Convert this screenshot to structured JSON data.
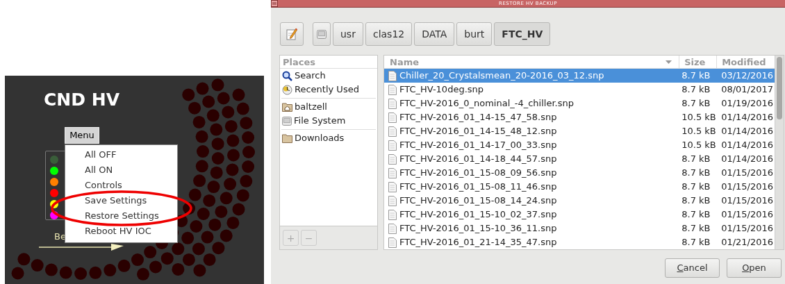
{
  "hv_panel": {
    "title": "CND HV",
    "menu_button": "Menu",
    "legend_dots": [
      {
        "color": "#3a5e3a"
      },
      {
        "color": "#00ff00"
      },
      {
        "color": "#ff8000"
      },
      {
        "color": "#ff0000"
      },
      {
        "color": "#ffff00"
      },
      {
        "color": "#ff00ff"
      }
    ],
    "menu_items": [
      "All OFF",
      "All ON",
      "Controls",
      "Save Settings",
      "Restore Settings",
      "Reboot HV IOC"
    ],
    "partial_label": "Be"
  },
  "dialog": {
    "title": "RESTORE HV BACKUP",
    "path_buttons": [
      {
        "label": "usr",
        "current": false
      },
      {
        "label": "clas12",
        "current": false
      },
      {
        "label": "DATA",
        "current": false
      },
      {
        "label": "burt",
        "current": false
      },
      {
        "label": "FTC_HV",
        "current": true
      }
    ],
    "places_header": "Places",
    "places": [
      {
        "kind": "search",
        "label": "Search"
      },
      {
        "kind": "recent",
        "label": "Recently Used"
      },
      {
        "kind": "home",
        "label": "baltzell"
      },
      {
        "kind": "drive",
        "label": "File System"
      },
      {
        "kind": "folder",
        "label": "Downloads"
      }
    ],
    "places_buttons": [
      "+",
      "−"
    ],
    "columns": [
      "Name",
      "Size",
      "Modified"
    ],
    "files": [
      {
        "name": "Chiller_20_Crystalsmean_20-2016_03_12.snp",
        "size": "8.7 kB",
        "modified": "03/12/2016",
        "selected": true
      },
      {
        "name": "FTC_HV-10deg.snp",
        "size": "8.7 kB",
        "modified": "08/01/2017",
        "selected": false
      },
      {
        "name": "FTC_HV-2016_0_nominal_-4_chiller.snp",
        "size": "8.7 kB",
        "modified": "01/19/2016",
        "selected": false
      },
      {
        "name": "FTC_HV-2016_01_14-15_47_58.snp",
        "size": "10.5 kB",
        "modified": "01/14/2016",
        "selected": false
      },
      {
        "name": "FTC_HV-2016_01_14-15_48_12.snp",
        "size": "10.5 kB",
        "modified": "01/14/2016",
        "selected": false
      },
      {
        "name": "FTC_HV-2016_01_14-17_00_33.snp",
        "size": "10.5 kB",
        "modified": "01/14/2016",
        "selected": false
      },
      {
        "name": "FTC_HV-2016_01_14-18_44_57.snp",
        "size": "8.7 kB",
        "modified": "01/14/2016",
        "selected": false
      },
      {
        "name": "FTC_HV-2016_01_15-08_09_56.snp",
        "size": "8.7 kB",
        "modified": "01/15/2016",
        "selected": false
      },
      {
        "name": "FTC_HV-2016_01_15-08_11_46.snp",
        "size": "8.7 kB",
        "modified": "01/15/2016",
        "selected": false
      },
      {
        "name": "FTC_HV-2016_01_15-08_14_24.snp",
        "size": "8.7 kB",
        "modified": "01/15/2016",
        "selected": false
      },
      {
        "name": "FTC_HV-2016_01_15-10_02_37.snp",
        "size": "8.7 kB",
        "modified": "01/15/2016",
        "selected": false
      },
      {
        "name": "FTC_HV-2016_01_15-10_36_11.snp",
        "size": "8.7 kB",
        "modified": "01/15/2016",
        "selected": false
      },
      {
        "name": "FTC_HV-2016_01_21-14_35_47.snp",
        "size": "8.7 kB",
        "modified": "01/21/2016",
        "selected": false
      }
    ],
    "buttons": [
      {
        "label": "Cancel",
        "underline_first": true
      },
      {
        "label": "Open",
        "underline_first": true
      }
    ]
  }
}
